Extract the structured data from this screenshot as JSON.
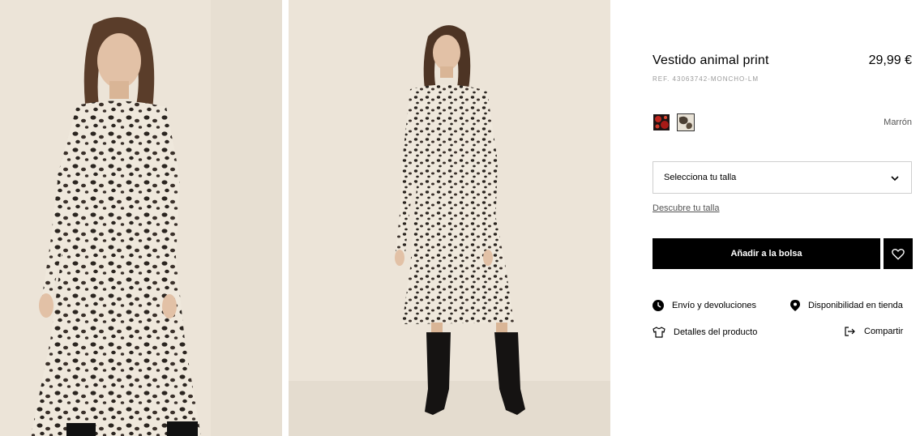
{
  "product": {
    "name": "Vestido animal print",
    "price": "29,99 €",
    "reference": "REF. 43063742-MONCHO-LM"
  },
  "colors": {
    "options": [
      {
        "icon": "red-floral-swatch",
        "swatch_color": "#8b1a1a"
      },
      {
        "icon": "brown-print-swatch",
        "swatch_color": "#6b5a45"
      }
    ],
    "selected_name": "Marrón"
  },
  "size": {
    "select_label": "Selecciona tu talla",
    "guide_link": "Descubre tu talla"
  },
  "actions": {
    "add_to_bag": "Añadir a la bolsa",
    "wishlist_icon": "heart-icon"
  },
  "links": {
    "shipping": "Envío y devoluciones",
    "store_availability": "Disponibilidad en tienda",
    "product_details": "Detalles del producto",
    "share": "Compartir"
  },
  "images": [
    {
      "alt_icon": "model-photo-front"
    },
    {
      "alt_icon": "model-photo-full-length"
    }
  ]
}
